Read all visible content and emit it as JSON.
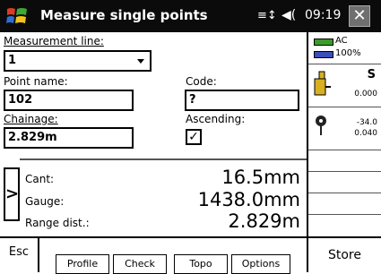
{
  "titlebar": {
    "title": "Measure single points",
    "clock": "09:19",
    "signal_icon": "≡↕",
    "volume_icon": "◀(",
    "close_label": "✕"
  },
  "form": {
    "measurement_line_label": "Measurement line:",
    "measurement_line_value": "1",
    "point_name_label": "Point name:",
    "point_name_value": "102",
    "code_label": "Code:",
    "code_value": "?",
    "chainage_label": "Chainage:",
    "chainage_value": "2.829m",
    "ascending_label": "Ascending:",
    "ascending_checked": "✓"
  },
  "results": {
    "cant_label": "Cant:",
    "cant_value": "16.5mm",
    "gauge_label": "Gauge:",
    "gauge_value": "1438.0mm",
    "range_label": "Range dist.:",
    "range_value": "2.829m",
    "nav_arrow": ">"
  },
  "status": {
    "power_label": "AC",
    "battery_label": "100%",
    "prism_s": "S",
    "prism_value": "0.000",
    "target_top": "-34.0",
    "target_bottom": "0.040",
    "colors": {
      "power": "#3c9a2e",
      "battery": "#3a4fb8",
      "prism": "#d8b020"
    }
  },
  "toolbar": {
    "esc_label": "Esc",
    "tabs": [
      "Profile",
      "Check",
      "Topo",
      "Options"
    ],
    "store_label": "Store"
  }
}
